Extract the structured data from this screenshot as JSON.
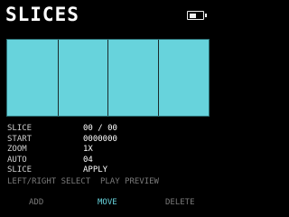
{
  "screen": {
    "title": "SLICES"
  },
  "battery": {
    "icon": "battery-icon",
    "level": 0.6
  },
  "waveform": {
    "color": "#67d3dc",
    "slice_markers": 3
  },
  "info": {
    "rows": [
      {
        "label": "SLICE",
        "value": "00 / 00"
      },
      {
        "label": "START",
        "value": "0000000"
      },
      {
        "label": "ZOOM",
        "value": "1X"
      },
      {
        "label": "AUTO",
        "value": "04"
      },
      {
        "label": "SLICE",
        "value": "APPLY"
      }
    ]
  },
  "hint": {
    "text": "LEFT/RIGHT SELECT  PLAY PREVIEW"
  },
  "softkeys": {
    "add": "ADD",
    "move": "MOVE",
    "delete": "DELETE"
  },
  "colors": {
    "accent": "#67d3dc",
    "dim": "#7a7a7a"
  }
}
